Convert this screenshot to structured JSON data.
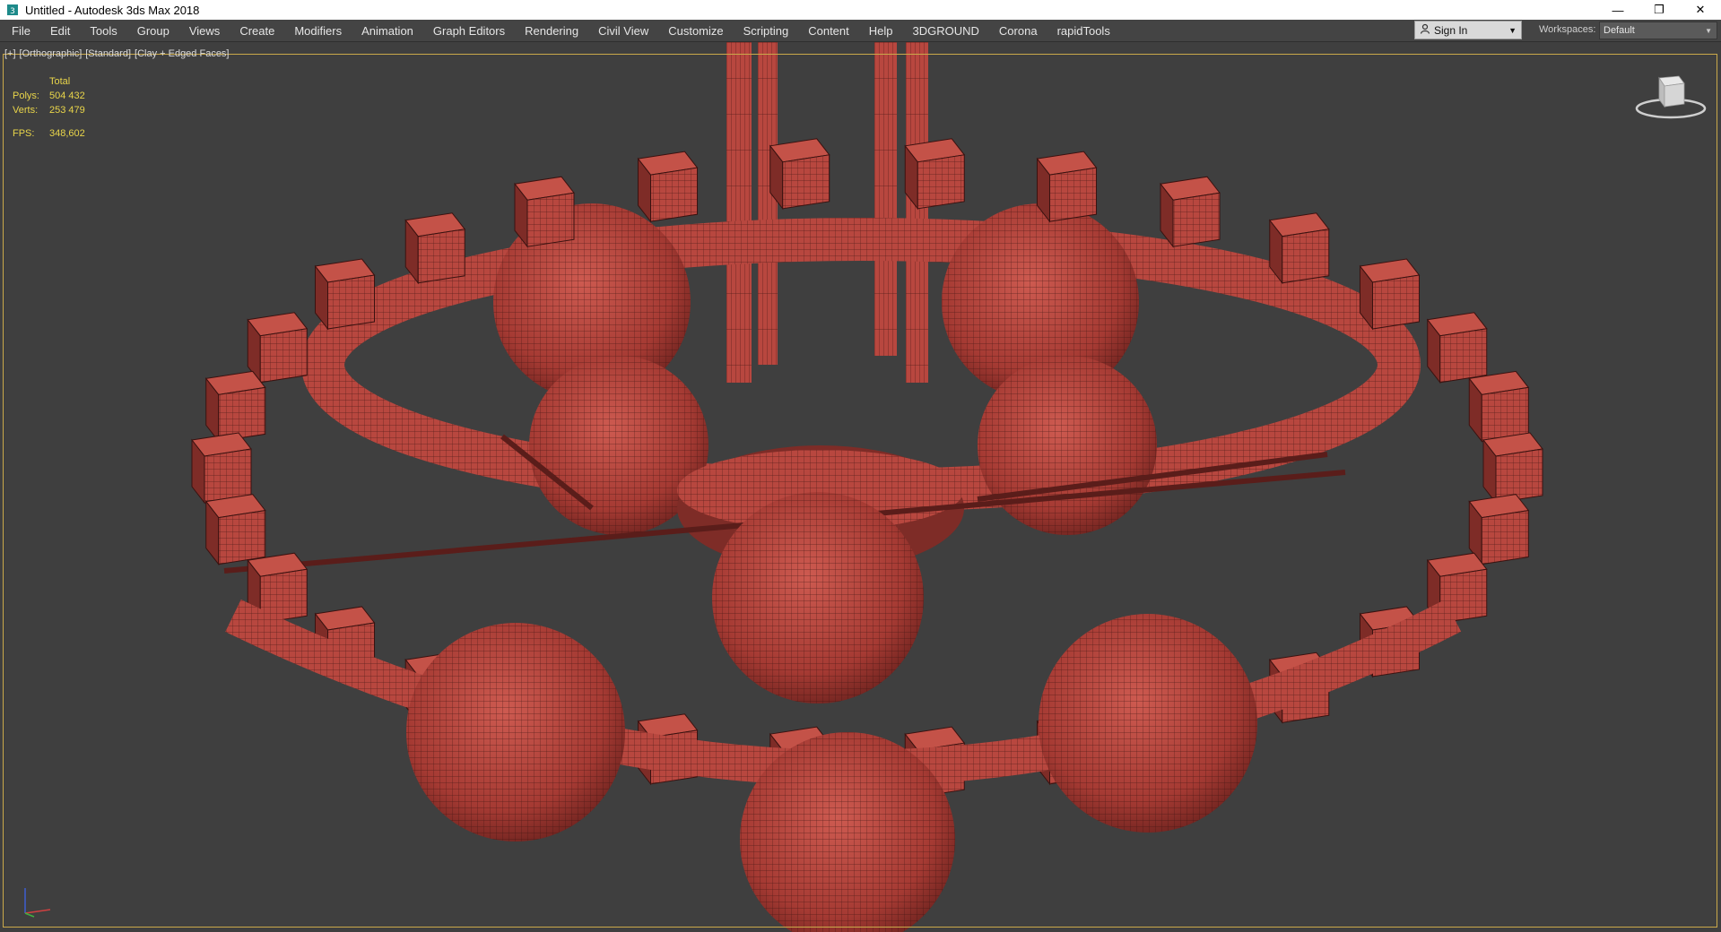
{
  "window": {
    "title": "Untitled - Autodesk 3ds Max 2018",
    "icon": "3dsmax-app-icon",
    "buttons": {
      "minimize": "—",
      "restore": "❐",
      "close": "✕"
    }
  },
  "menu": {
    "items": [
      "File",
      "Edit",
      "Tools",
      "Group",
      "Views",
      "Create",
      "Modifiers",
      "Animation",
      "Graph Editors",
      "Rendering",
      "Civil View",
      "Customize",
      "Scripting",
      "Content",
      "Help",
      "3DGROUND",
      "Corona",
      "rapidTools"
    ],
    "sign_in": "Sign In",
    "workspaces_label": "Workspaces:",
    "workspace_value": "Default"
  },
  "viewport": {
    "label_parts": [
      "[+]",
      "[Orthographic]",
      "[Standard]",
      "[Clay + Edged Faces]"
    ],
    "stats": {
      "header": "Total",
      "polys_label": "Polys:",
      "polys_value": "504 432",
      "verts_label": "Verts:",
      "verts_value": "253 479",
      "fps_label": "FPS:",
      "fps_value": "348,602"
    },
    "colors": {
      "background": "#3f3f3f",
      "model": "#b8473f",
      "model_dark": "#7e2c27",
      "wire": "#3a1210",
      "stats_text": "#e9d54a",
      "frame": "#caa94a"
    }
  }
}
